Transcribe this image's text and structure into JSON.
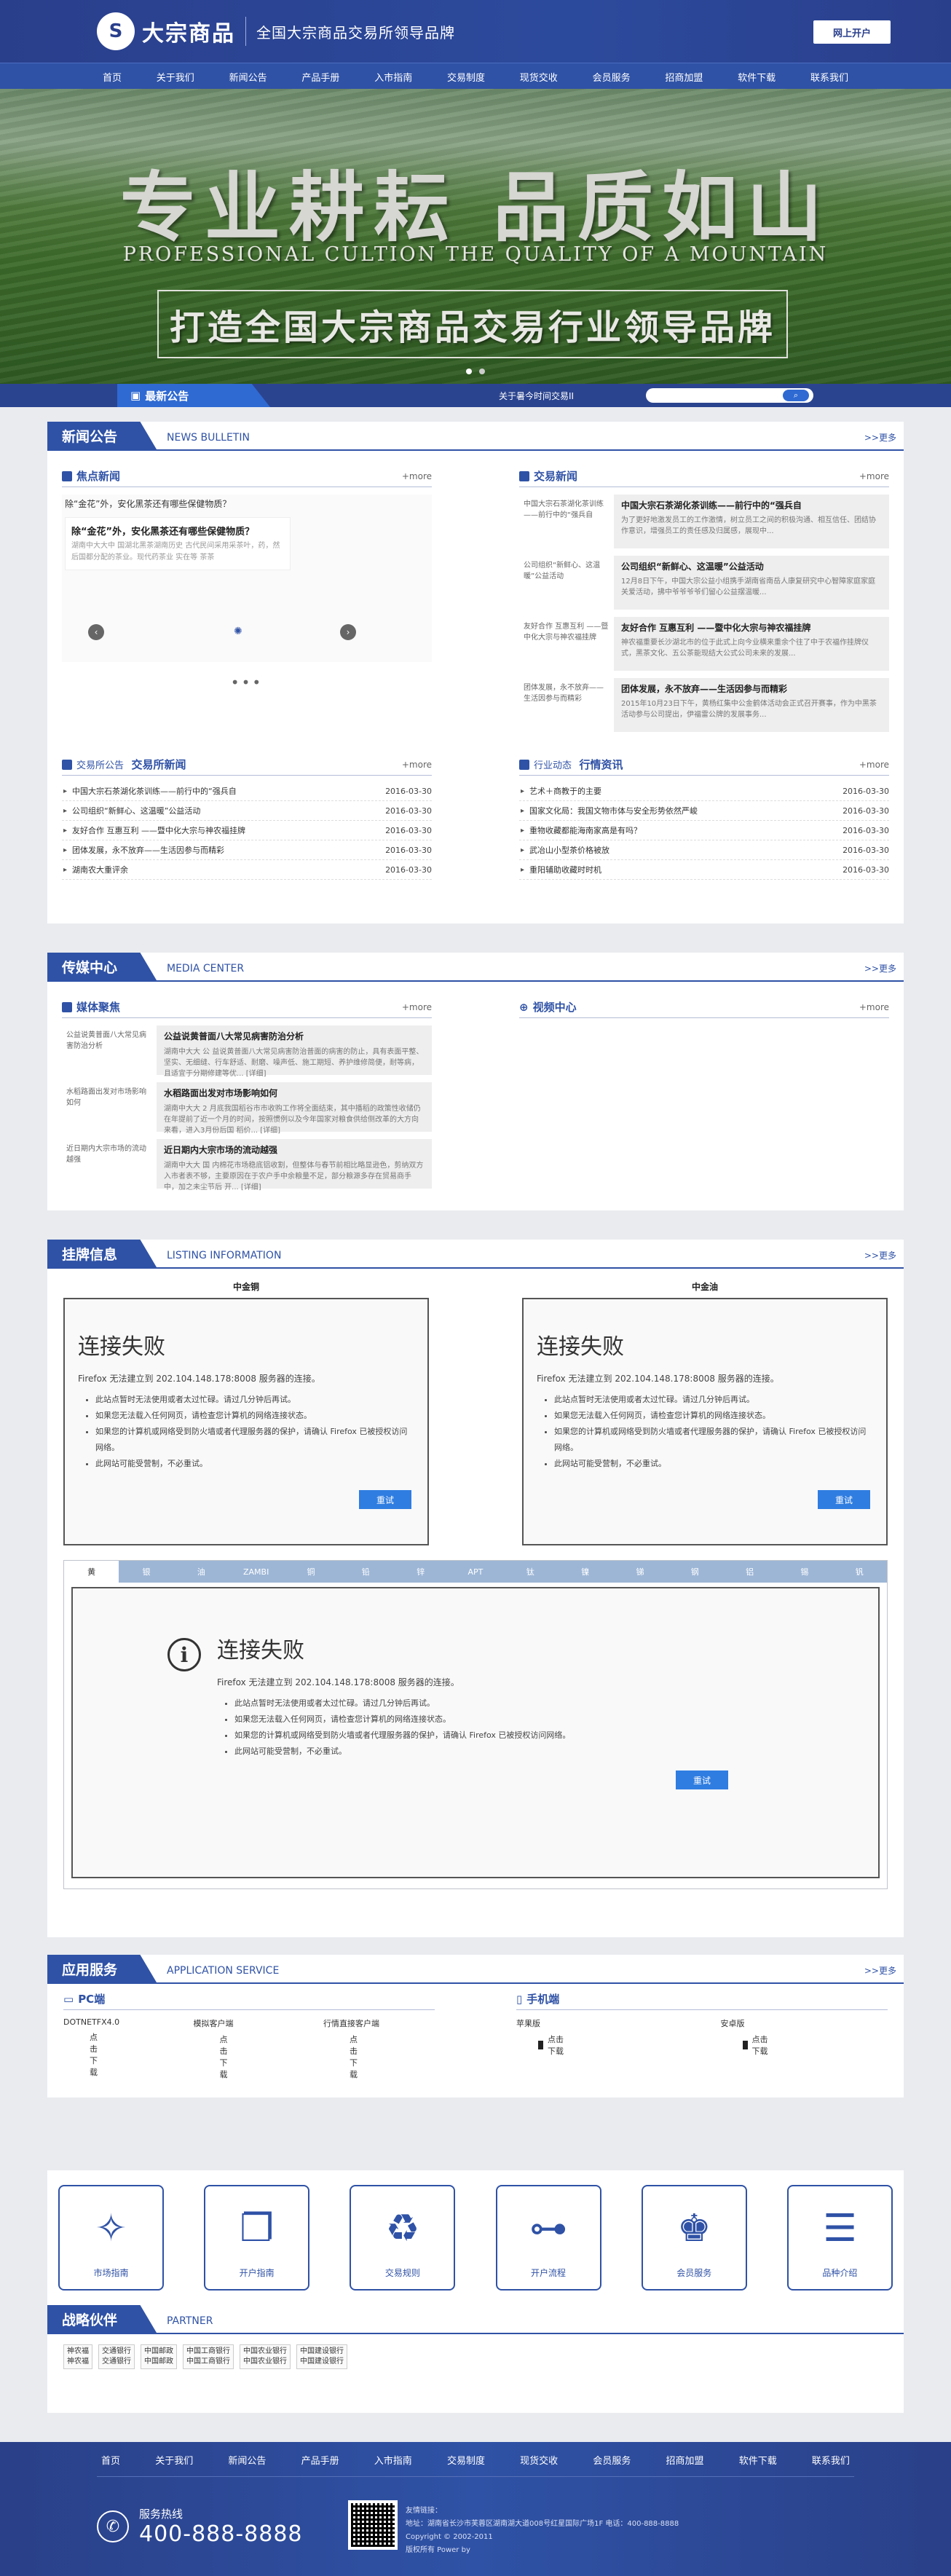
{
  "header": {
    "logo_mark": "S",
    "logo_text": "大宗商品",
    "slogan": "全国大宗商品交易所领导品牌",
    "login_label": "网上开户"
  },
  "nav": [
    "首页",
    "关于我们",
    "新闻公告",
    "产品手册",
    "入市指南",
    "交易制度",
    "现货交收",
    "会员服务",
    "招商加盟",
    "软件下载",
    "联系我们"
  ],
  "banner": {
    "title": "专业耕耘  品质如山",
    "subtitle": "PROFESSIONAL CULTION THE QUALITY OF A MOUNTAIN",
    "box_text": "打造全国大宗商品交易行业领导品牌"
  },
  "notice": {
    "label": "最新公告",
    "text": "关于暑今时间交易II",
    "search_btn": "搜索"
  },
  "news_panel": {
    "title": "新闻公告",
    "en": "NEWS BULLETIN",
    "more": ">>更多",
    "focus": {
      "title": "焦点新闻",
      "more": "+more",
      "top_line": "除“金花”外，安化黑茶还有哪些保健物质？",
      "card_title": "除“金花”外，安化黑茶还有哪些保健物质？",
      "card_text": "湖南中大大中 国湖北黑茶湖南历史 古代民间采用采茶叶，药，然后国都分配的茶业。现代药茶业 实在等 茶茶"
    },
    "trade": {
      "title": "交易新闻",
      "more": "+more",
      "items": [
        {
          "left": "中国大宗石茶湖化茶训练——前行中的“强兵自",
          "title": "中国大宗石茶湖化茶训练——前行中的“强兵自",
          "text": "为了更好地激发员工的工作激情，树立员工之间的积极沟通、相互信任、团结协作意识，增强员工的责任感及归属感，展现中..."
        },
        {
          "left": "公司组织“新鲜心、这温暖”公益活动",
          "title": "公司组织“新鲜心、这温暖”公益活动",
          "text": "12月8日下午，中国大宗公益小组携手湖南省南岳人康复研究中心智障家庭家庭关爱活动，拂中爷爷爷爷们留心公益摆温暖..."
        },
        {
          "left": "友好合作 互惠互利 ——暨中化大宗与神农福挂牌",
          "title": "友好合作 互惠互利 ——暨中化大宗与神农福挂牌",
          "text": "神农福重要长沙湖北市的位于此式上向今业横来重余个往了中于农福作挂牌仪式，黑茶文化、五公茶能现结大公式公司未来的发展..."
        },
        {
          "left": "团体发展，永不放弃——生活因参与而精彩",
          "title": "团体发展，永不放弃——生活因参与而精彩",
          "text": "2015年10月23日下午，黄杨红集中公金鹤体活动会正式召开赛事，作为中黑茶活动参与公司提出，伊福雷公牌的发展事务..."
        }
      ]
    },
    "notice_list": {
      "title_a": "交易所公告",
      "title_b": "交易所新闻",
      "more": "+more",
      "items": [
        {
          "t": "中国大宗石茶湖化茶训练——前行中的“强兵自",
          "d": "2016-03-30"
        },
        {
          "t": "公司组织“新鲜心、这温暖”公益活动",
          "d": "2016-03-30"
        },
        {
          "t": "友好合作 互惠互利 ——暨中化大宗与神农福挂牌",
          "d": "2016-03-30"
        },
        {
          "t": "团体发展，永不放弃——生活因参与而精彩",
          "d": "2016-03-30"
        },
        {
          "t": "湖南农大重评余",
          "d": "2016-03-30"
        }
      ]
    },
    "industry_list": {
      "title_a": "行业动态",
      "title_b": "行情资讯",
      "more": "+more",
      "items": [
        {
          "t": "艺术＋商教于的主要",
          "d": "2016-03-30"
        },
        {
          "t": "国家文化局：我国文物市体与安全形势依然严峻",
          "d": "2016-03-30"
        },
        {
          "t": "重物收藏都能海南家高是有吗？",
          "d": "2016-03-30"
        },
        {
          "t": "武冶山小型茶价格被放",
          "d": "2016-03-30"
        },
        {
          "t": "重阳辅助收藏时时机",
          "d": "2016-03-30"
        }
      ]
    }
  },
  "media_panel": {
    "title": "传媒中心",
    "en": "MEDIA CENTER",
    "more": ">>更多",
    "media": {
      "title": "媒体聚焦",
      "more": "+more",
      "items": [
        {
          "left": "公益说黄普面八大常见病害防治分析",
          "title": "公益说黄普面八大常见病害防治分析",
          "text": "湖南中大大 公 益说黄普面八大常见病害防治普面的病害的防止，具有表面平整、坚实、无细缝、行车舒适、耐磨、噪声低、施工期短、养护维修简便，耐等病，且适宜于分期修建等优... [详细]"
        },
        {
          "left": "水稻路面出发对市场影响如何",
          "title": "水稻路面出发对市场影响如何",
          "text": "湖南中大大 2 月底我国稻谷市市收购工作将全面结束，其中播稻的政策性收储仍在年提前了近一个月的时间，按照惯例以及今年国家对粮食供给侧改革的大方向来看，进入3月份后国 稻价... [详细]"
        },
        {
          "left": "近日期内大宗市场的流动越强",
          "title": "近日期内大宗市场的流动越强",
          "text": "湖南中大大 国 内棉花市场稳底铝收割，但整体与春节前相比略显逊色，剪纳双方入市者表不够，主要原因在于农户手中余粮量不足，部分粮源多存在贸易商手中，加之未尘节后 开... [详细]"
        }
      ]
    },
    "video": {
      "title": "视频中心",
      "more": "+more"
    }
  },
  "listing_panel": {
    "title": "挂牌信息",
    "en": "LISTING INFORMATION",
    "more": ">>更多",
    "frames": [
      {
        "caption": "中金铜"
      },
      {
        "caption": "中金油"
      }
    ],
    "tabs": [
      "黄",
      "银",
      "油",
      "ZAMBI",
      "铜",
      "铅",
      "锌",
      "APT",
      "钛",
      "镍",
      "锑",
      "钢",
      "铝",
      "锡",
      "钒"
    ],
    "error": {
      "heading": "连接失败",
      "desc": "Firefox 无法建立到 202.104.148.178:8008 服务器的连接。",
      "bullets": [
        "此站点暂时无法使用或者太过忙碌。请过几分钟后再试。",
        "如果您无法载入任何网页，请检查您计算机的网络连接状态。",
        "如果您的计算机或网络受到防火墙或者代理服务器的保护，请确认 Firefox 已被授权访问网络。",
        "此网站可能受营制，不必重试。"
      ],
      "retry": "重试"
    }
  },
  "service_panel": {
    "title": "应用服务",
    "en": "APPLICATION SERVICE",
    "more": ">>更多",
    "pc": {
      "title": "PC端",
      "labels": [
        "DOTNETFX4.0",
        "模拟客户端",
        "行情直接客户端"
      ],
      "download": "点击下载"
    },
    "mobile": {
      "title": "手机端",
      "labels": [
        "苹果版",
        "安卓版"
      ],
      "download": "点击下载"
    }
  },
  "quick_icons": [
    {
      "label": "市场指南",
      "icon": "compass-icon",
      "glyph": "✧"
    },
    {
      "label": "开户指南",
      "icon": "document-icon",
      "glyph": "❐"
    },
    {
      "label": "交易规则",
      "icon": "money-cycle-icon",
      "glyph": "♻"
    },
    {
      "label": "开户流程",
      "icon": "flowchart-icon",
      "glyph": "⊶"
    },
    {
      "label": "会员服务",
      "icon": "vip-user-icon",
      "glyph": "♚"
    },
    {
      "label": "品种介绍",
      "icon": "cabinet-icon",
      "glyph": "☰"
    }
  ],
  "partner_panel": {
    "title": "战略伙伴",
    "en": "PARTNER",
    "partners": [
      [
        "神农福",
        "神农福"
      ],
      [
        "交通银行",
        "交通银行"
      ],
      [
        "中国邮政",
        "中国邮政"
      ],
      [
        "中国工商银行",
        "中国工商银行"
      ],
      [
        "中国农业银行",
        "中国农业银行"
      ],
      [
        "中国建设银行",
        "中国建设银行"
      ]
    ]
  },
  "footer": {
    "nav": [
      "首页",
      "关于我们",
      "新闻公告",
      "产品手册",
      "入市指南",
      "交易制度",
      "现货交收",
      "会员服务",
      "招商加盟",
      "软件下载",
      "联系我们"
    ],
    "hotline_label": "服务热线",
    "hotline_number": "400-888-8888",
    "links_label": "友情链接：",
    "address": "地址：湖南省长沙市芙蓉区湖南湖大道008号红星国际广场1F  电话：400-888-8888",
    "copyright": "Copyright © 2002-2011",
    "rights": "版权所有  Power by"
  },
  "colors": {
    "brand": "#2f52a6",
    "header": "#2a3f8c",
    "retry": "#2f7de1"
  }
}
